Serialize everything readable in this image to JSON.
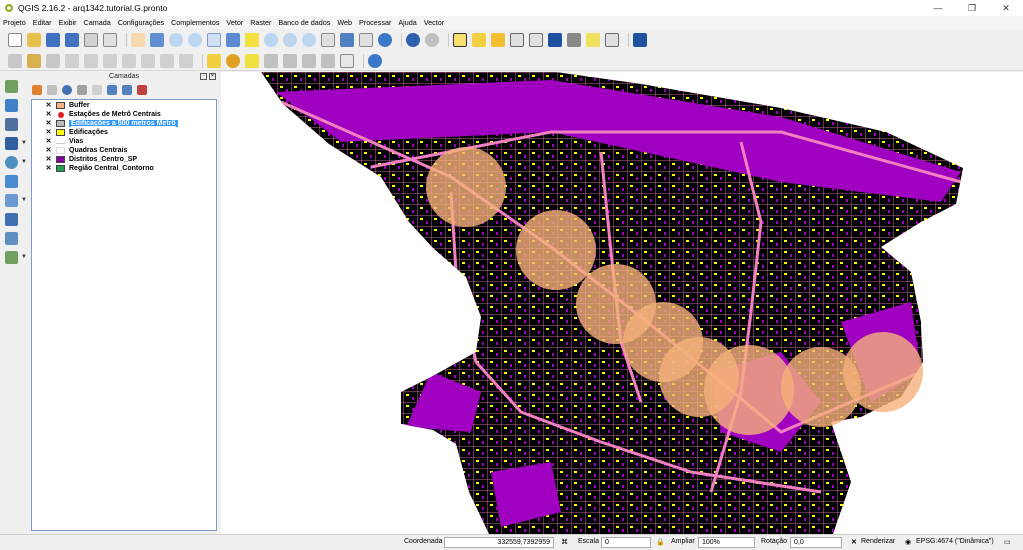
{
  "window": {
    "title": "QGIS 2.16.2 - arq1342.tutorial.G.pronto",
    "minimize": "—",
    "maximize": "❐",
    "close": "✕"
  },
  "menu": [
    "Projeto",
    "Editar",
    "Exibir",
    "Camada",
    "Configurações",
    "Complementos",
    "Vetor",
    "Raster",
    "Banco de dados",
    "Web",
    "Processar",
    "Ajuda",
    "Vector"
  ],
  "layers_panel": {
    "title": "Camadas",
    "layers": [
      {
        "name": "Buffer",
        "checked": "✕",
        "color": "#f7b482",
        "selected": false
      },
      {
        "name": "Estações de Metrô Centrais",
        "checked": "✕",
        "color": "#e02020",
        "selected": false
      },
      {
        "name": "Edificações a 500 metros Metrô",
        "checked": "✕",
        "color": "#b9b9b9",
        "selected": true
      },
      {
        "name": "Edificações",
        "checked": "✕",
        "color": "#ffff00",
        "selected": false
      },
      {
        "name": "Vias",
        "checked": "✕",
        "color": "#ffffff",
        "selected": false
      },
      {
        "name": "Quadras Centrais",
        "checked": "✕",
        "color": "#ffffff",
        "selected": false
      },
      {
        "name": "Distritos_Centro_SP",
        "checked": "✕",
        "color": "#8000a0",
        "selected": false
      },
      {
        "name": "Região Central_Contorno",
        "checked": "✕",
        "color": "#22a050",
        "selected": false
      }
    ]
  },
  "map": {
    "colors": {
      "blocks": "#000000",
      "district": "#a000c0",
      "roads": "#f080c0",
      "buildings": "#ffff00",
      "buffer": "#f5b27a"
    }
  },
  "status": {
    "coord_label": "Coordenada",
    "coord_value": "332559,7392959",
    "scale_label": "Escala",
    "scale_value": "0",
    "magnify_label": "Ampliar",
    "magnify_value": "100%",
    "rotation_label": "Rotação",
    "rotation_value": "0,0",
    "render_label": "Renderizar",
    "crs": "EPSG:4674 (\"Dinâmica\")"
  }
}
